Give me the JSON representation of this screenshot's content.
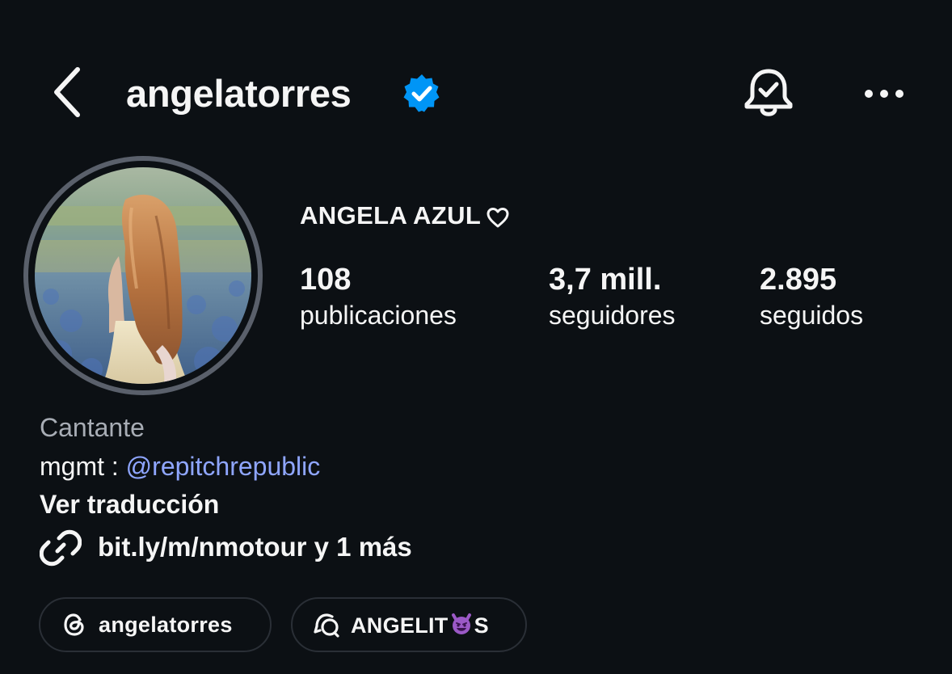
{
  "header": {
    "username": "angelatorres",
    "icons": {
      "back": "chevron-left-icon",
      "verified": "verified-badge-icon",
      "notifications": "bell-check-icon",
      "more": "more-horizontal-icon"
    }
  },
  "profile": {
    "display_name": "ANGELA AZUL",
    "name_icon": "heart-outline-icon",
    "stats": [
      {
        "value": "108",
        "label": "publicaciones"
      },
      {
        "value": "3,7 mill.",
        "label": "seguidores"
      },
      {
        "value": "2.895",
        "label": "seguidos"
      }
    ]
  },
  "bio": {
    "category": "Cantante",
    "mgmt_prefix": "mgmt : ",
    "mgmt_mention": "@repitchrepublic",
    "translate": "Ver traducción",
    "link": "bit.ly/m/nmotour y 1 más",
    "link_icon": "link-icon"
  },
  "chips": [
    {
      "label": "angelatorres",
      "icon": "threads-icon"
    },
    {
      "label_before": "ANGELIT",
      "emoji": "smiling-devil-emoji",
      "label_after": "S",
      "icon": "broadcast-channel-icon"
    }
  ],
  "colors": {
    "background": "#0c1014",
    "text": "#f5f5f5",
    "secondary_text": "#a8adb5",
    "mention": "#8fa6ff",
    "verified": "#0095f6",
    "avatar_ring": "#5a606b",
    "chip_border": "#2a2f36"
  }
}
